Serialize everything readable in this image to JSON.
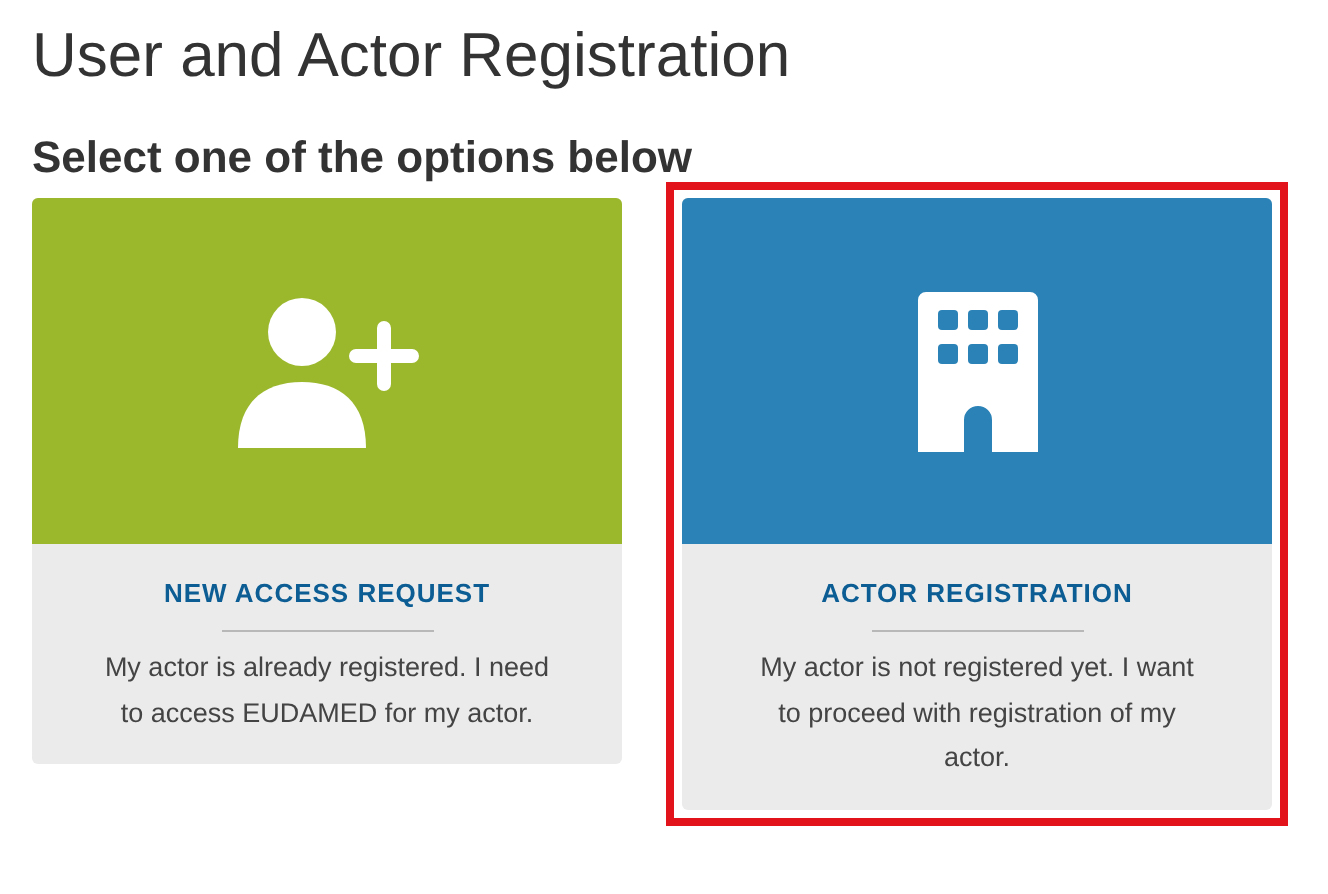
{
  "page_title": "User and Actor Registration",
  "subtitle": "Select one of the options below",
  "options": [
    {
      "kind": "person-add",
      "color": "#9bb82d",
      "title": "NEW ACCESS REQUEST",
      "description": "My actor is already registered. I need to access EUDAMED for my actor.",
      "selected": false
    },
    {
      "kind": "building",
      "color": "#2a82b7",
      "title": "ACTOR REGISTRATION",
      "description": "My actor is not registered yet. I want to proceed with registration of my actor.",
      "selected": true
    }
  ]
}
